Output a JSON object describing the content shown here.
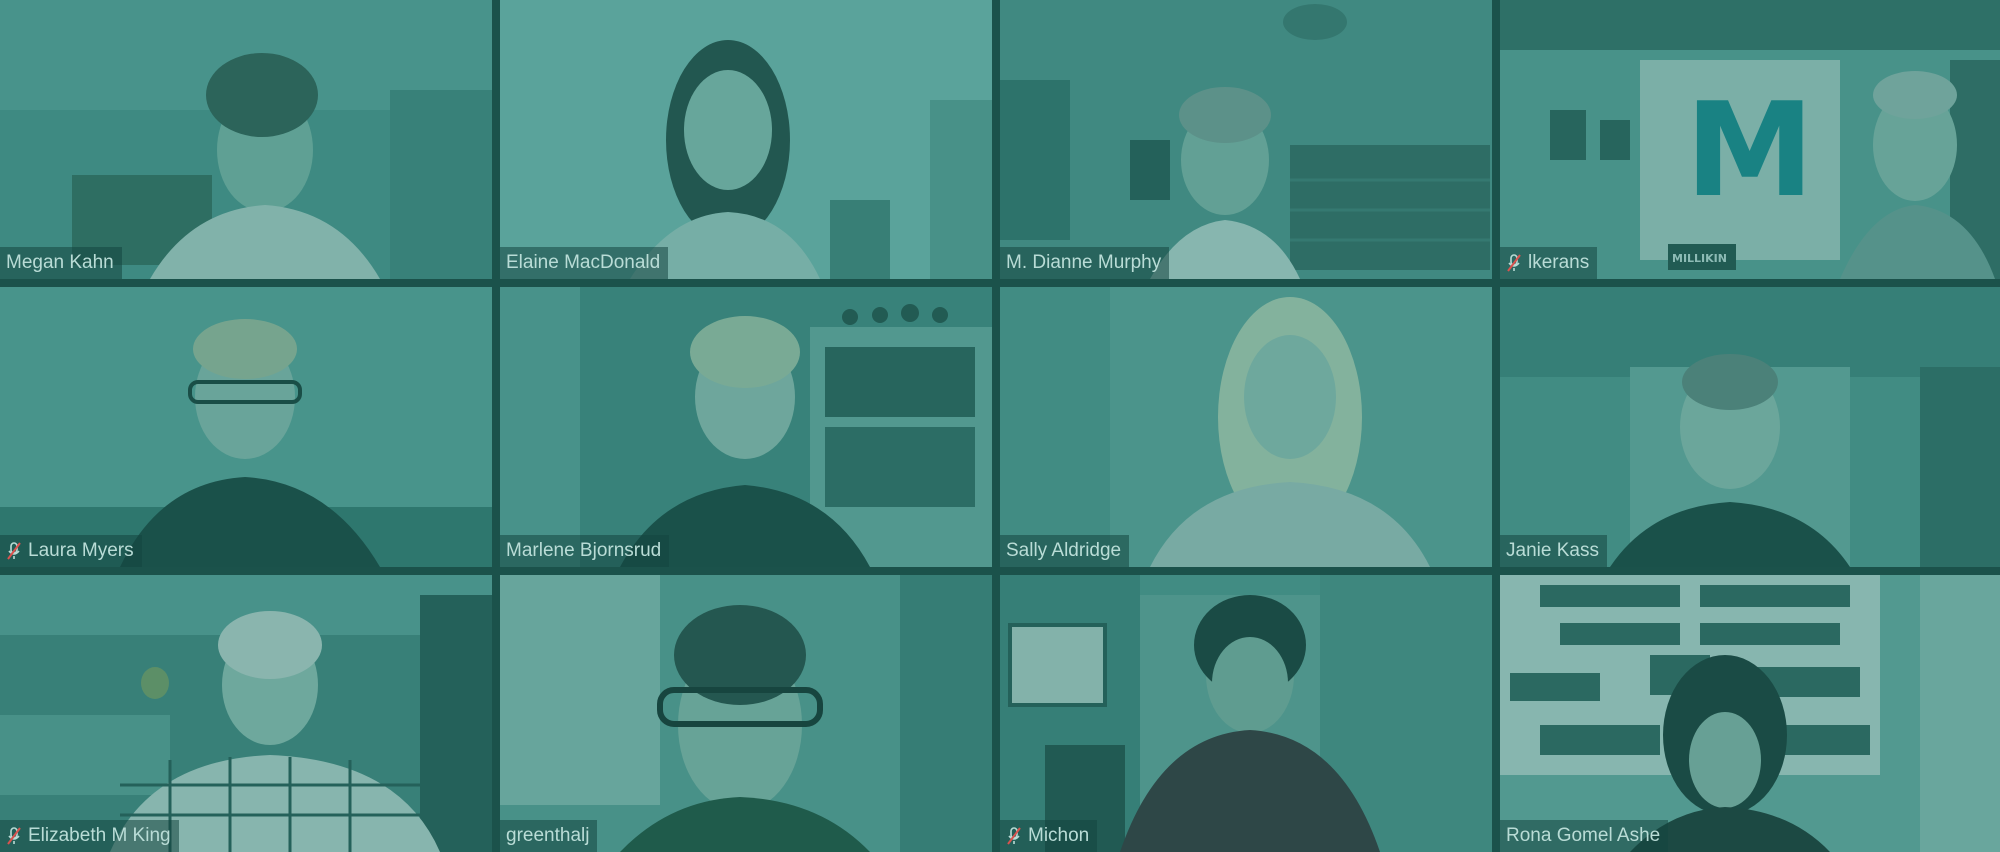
{
  "meeting": {
    "participants": [
      {
        "name": "Megan Kahn",
        "muted": false
      },
      {
        "name": "Elaine MacDonald",
        "muted": false,
        "active_speaker": true
      },
      {
        "name": "M. Dianne Murphy",
        "muted": false
      },
      {
        "name": "lkerans",
        "muted": true
      },
      {
        "name": "Laura Myers",
        "muted": true
      },
      {
        "name": "Marlene Bjornsrud",
        "muted": false
      },
      {
        "name": "Sally Aldridge",
        "muted": false
      },
      {
        "name": "Janie Kass",
        "muted": false
      },
      {
        "name": "Elizabeth M King",
        "muted": true
      },
      {
        "name": "greenthalj",
        "muted": false
      },
      {
        "name": "Michon",
        "muted": true
      },
      {
        "name": "Rona Gomel Ashe",
        "muted": false
      }
    ],
    "background_text": {
      "banner_letter": "M",
      "pennant_text": "MILLIKIN"
    }
  },
  "colors": {
    "tint": "#127064",
    "active_border": "#4fb58c",
    "name_text": "#b9dcd6",
    "muted_icon": "#d9534f"
  }
}
